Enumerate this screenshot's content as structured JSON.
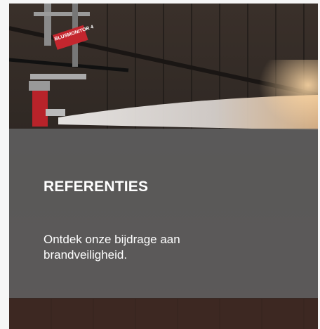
{
  "card": {
    "image_alt_subject": "fire-monitor-spraying-water",
    "sign_text": "BLUSMONITOR 4",
    "title": "REFERENTIES",
    "description": "Ontdek onze bijdrage aan brandveiligheid."
  },
  "colors": {
    "overlay": "#626262",
    "sign_red": "#c4262e",
    "text": "#ffffff",
    "page_bg": "#f6f6f6"
  }
}
